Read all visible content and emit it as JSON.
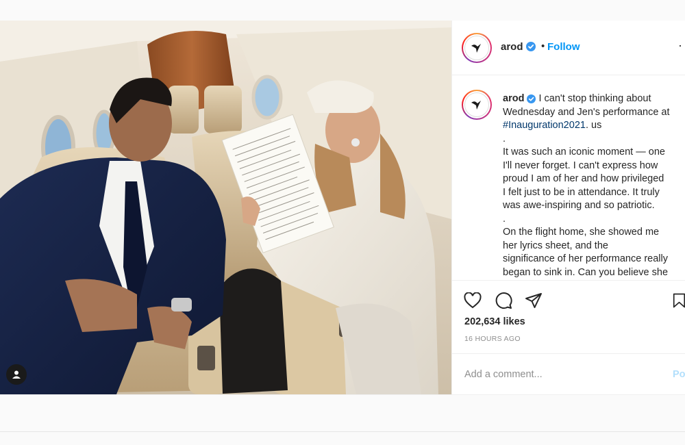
{
  "post": {
    "username": "arod",
    "follow_label": "Follow",
    "separator": "•",
    "more_label": "···",
    "caption_username": "arod",
    "caption_lines": [
      "I can't stop thinking about",
      "Wednesday and Jen's performance at",
      "#Inauguration2021. us",
      ".",
      "It was such an iconic moment — one",
      "I'll never forget. I can't express how",
      "proud I am of her and how privileged",
      "I felt just to be in attendance. It truly",
      "was awe-inspiring and so patriotic.",
      ".",
      "On the flight home, she showed me",
      "her lyrics sheet, and the",
      "significance  of her performance really",
      "began to sink in. Can you believe she"
    ],
    "hashtag": "#Inauguration2021",
    "likes": "202,634 likes",
    "timestamp": "16 HOURS AGO",
    "comment_placeholder": "Add a comment...",
    "post_label": "Po"
  },
  "icons": {
    "heart": "heart-icon",
    "comment": "comment-icon",
    "share": "share-icon",
    "save": "bookmark-icon",
    "verified": "verified-badge-icon",
    "tag": "user-tag-icon"
  },
  "colors": {
    "link_blue": "#0095f6",
    "hashtag": "#00376b",
    "muted": "#8e8e8e",
    "text": "#262626"
  }
}
